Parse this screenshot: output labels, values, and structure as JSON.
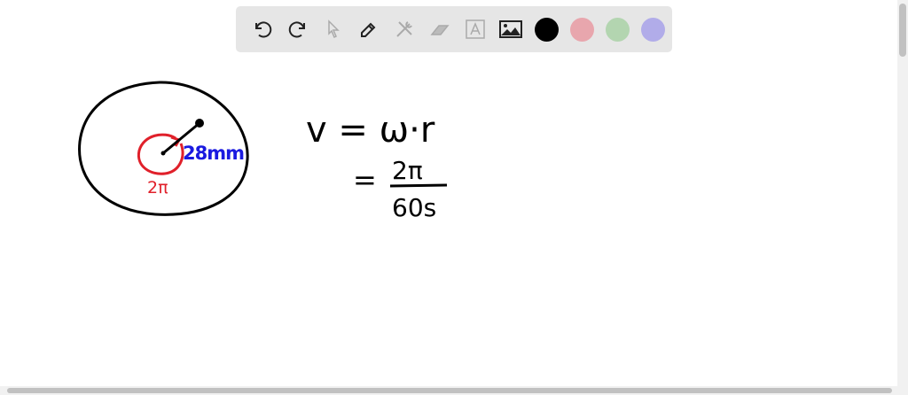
{
  "toolbar": {
    "tools": [
      "undo",
      "redo",
      "select",
      "pen",
      "tools",
      "eraser",
      "text",
      "image"
    ],
    "colors": {
      "black": "#000000",
      "red": "#e8a6ad",
      "green": "#b3d5b0",
      "blue": "#b1ace9"
    }
  },
  "drawing": {
    "radius_label": "28mm",
    "angle_label": "2π",
    "equation_line1": "v = ω·r",
    "equation_eq": "=",
    "numerator": "2π",
    "denominator": "60s",
    "ink_colors": {
      "black": "#000000",
      "red": "#e0202a",
      "blue": "#1a1ae0"
    }
  }
}
